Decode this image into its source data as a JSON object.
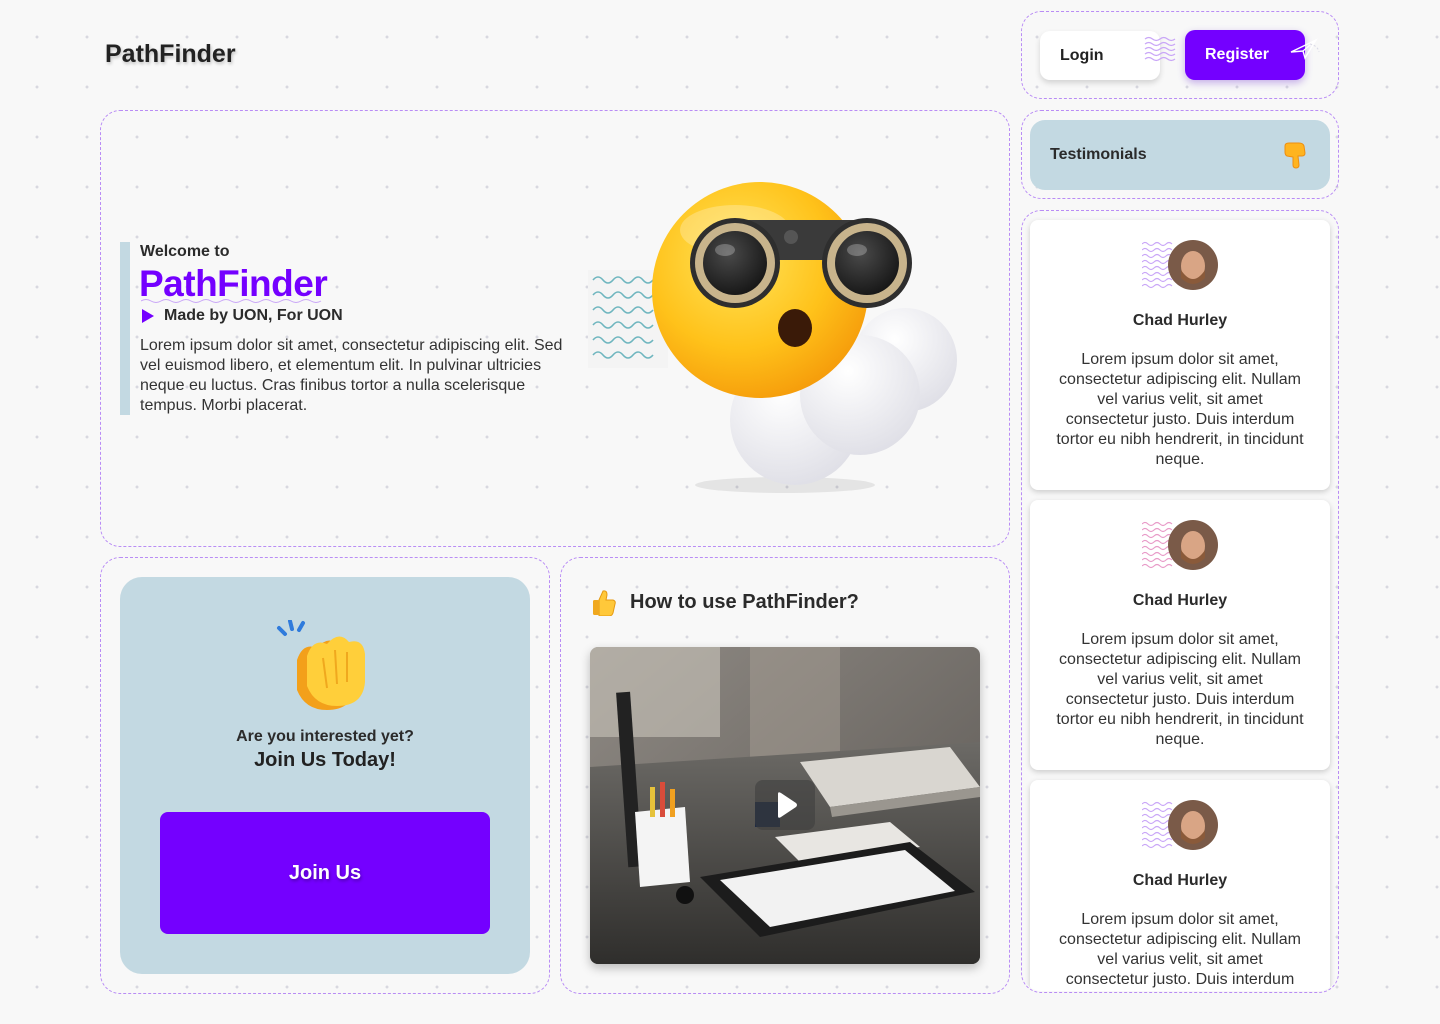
{
  "header": {
    "logo": "PathFinder",
    "login_label": "Login",
    "register_label": "Register"
  },
  "hero": {
    "welcome": "Welcome to",
    "title": "PathFinder",
    "tagline": "Made by UON, For UON",
    "body": "Lorem ipsum dolor sit amet, consectetur adipiscing elit. Sed vel euismod libero, et elementum elit. In pulvinar ultricies neque eu luctus. Cras finibus tortor a nulla scelerisque tempus. Morbi placerat."
  },
  "join": {
    "question": "Are you interested yet?",
    "subtitle": "Join Us Today!",
    "button_label": "Join Us"
  },
  "howto": {
    "title": "How to use PathFinder?"
  },
  "testimonials": {
    "header": "Testimonials",
    "items": [
      {
        "name": "Chad Hurley",
        "text": "Lorem ipsum dolor sit amet, consectetur adipiscing elit. Nullam vel varius velit, sit amet consectetur justo. Duis interdum tortor eu nibh hendrerit, in tincidunt neque."
      },
      {
        "name": "Chad Hurley",
        "text": "Lorem ipsum dolor sit amet, consectetur adipiscing elit. Nullam vel varius velit, sit amet consectetur justo. Duis interdum tortor eu nibh hendrerit, in tincidunt neque."
      },
      {
        "name": "Chad Hurley",
        "text": "Lorem ipsum dolor sit amet, consectetur adipiscing elit. Nullam vel varius velit, sit amet consectetur justo. Duis interdum tortor eu nibh hendrerit, in tincidunt neque."
      }
    ]
  },
  "icons": {
    "hero_illustration": "binoculars-emoji-icon",
    "join_illustration": "clapping-hands-icon",
    "howto_icon": "thumbs-up-icon",
    "testimonials_icon": "pointing-down-hand-icon",
    "video_play": "play-icon"
  },
  "colors": {
    "accent": "#7400ff",
    "panel": "#c3d9e2",
    "dashed_border": "#b98cf5",
    "background": "#f8f8f8"
  }
}
